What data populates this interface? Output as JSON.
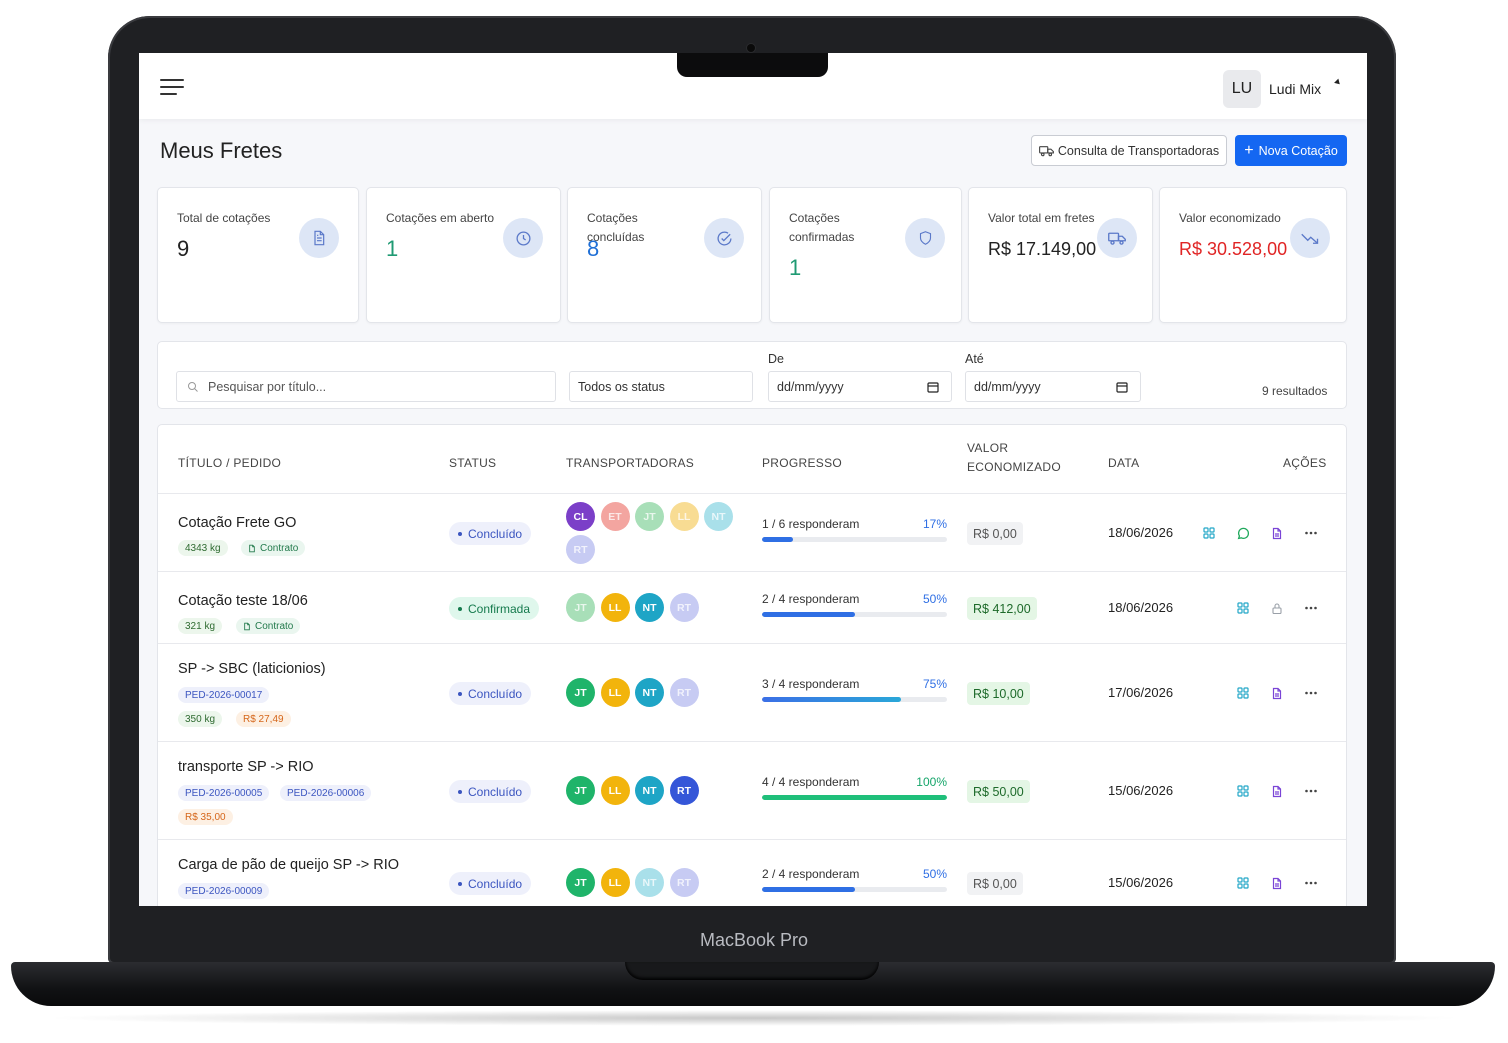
{
  "device_label": "MacBook Pro",
  "header": {
    "user_initials": "LU",
    "user_name": "Ludi Mix"
  },
  "page": {
    "title": "Meus Fretes",
    "btn_consulta": "Consulta de Transportadoras",
    "btn_nova": "Nova Cotação"
  },
  "cards": [
    {
      "label": "Total de cotações",
      "value": "9",
      "color": "#222222",
      "icon": "document-icon"
    },
    {
      "label": "Cotações em aberto",
      "value": "1",
      "color": "#1f9a73",
      "icon": "clock-icon"
    },
    {
      "label": "Cotações concluídas",
      "value": "8",
      "color": "#1f6fd6",
      "icon": "check-circle-icon"
    },
    {
      "label": "Cotações confirmadas",
      "value": "1",
      "color": "#1f9a73",
      "icon": "shield-icon"
    },
    {
      "label": "Valor total em fretes",
      "value": "R$ 17.149,00",
      "color": "#222222",
      "icon": "truck-icon"
    },
    {
      "label": "Valor economizado",
      "value": "R$ 30.528,00",
      "color": "#e02424",
      "icon": "trend-down-icon"
    }
  ],
  "filters": {
    "search_placeholder": "Pesquisar por título...",
    "status_value": "Todos os status",
    "from_label": "De",
    "from_value": "dd/mm/yyyy",
    "to_label": "Até",
    "to_value": "dd/mm/yyyy",
    "results": "9 resultados"
  },
  "table": {
    "headers": {
      "title": "TÍTULO / PEDIDO",
      "status": "STATUS",
      "carriers": "TRANSPORTADORAS",
      "progress": "PROGRESSO",
      "saved": "VALOR ECONOMIZADO",
      "date": "DATA",
      "actions": "AÇÕES"
    },
    "rows": [
      {
        "title": "Cotação Frete GO",
        "tags": [
          {
            "text": "4343 kg",
            "kind": "weight"
          },
          {
            "text": "Contrato",
            "kind": "contract"
          }
        ],
        "status": "Concluído",
        "carriers": [
          {
            "initials": "CL",
            "color": "#7b3fc8",
            "faded": false
          },
          {
            "initials": "ET",
            "color": "#f3a5a0",
            "faded": true
          },
          {
            "initials": "JT",
            "color": "#a8dfb8",
            "faded": true
          },
          {
            "initials": "LL",
            "color": "#f8dc93",
            "faded": true
          },
          {
            "initials": "NT",
            "color": "#a9e0ea",
            "faded": true
          },
          {
            "initials": "RT",
            "color": "#c7cbf3",
            "faded": true
          }
        ],
        "progress_text": "1 / 6 responderam",
        "progress_pct_label": "17%",
        "progress": 0.17,
        "saved": "R$ 0,00",
        "date": "18/06/2026",
        "actions": [
          "grid-icon",
          "chat-icon",
          "file-icon",
          "more-icon"
        ]
      },
      {
        "title": "Cotação teste 18/06",
        "tags": [
          {
            "text": "321 kg",
            "kind": "weight"
          },
          {
            "text": "Contrato",
            "kind": "contract"
          }
        ],
        "status": "Confirmada",
        "carriers": [
          {
            "initials": "JT",
            "color": "#a8dfb8",
            "faded": true
          },
          {
            "initials": "LL",
            "color": "#f2b40c",
            "faded": false
          },
          {
            "initials": "NT",
            "color": "#1ea5c6",
            "faded": false
          },
          {
            "initials": "RT",
            "color": "#c7cbf3",
            "faded": true
          }
        ],
        "progress_text": "2 / 4 responderam",
        "progress_pct_label": "50%",
        "progress": 0.5,
        "saved": "R$ 412,00",
        "date": "18/06/2026",
        "actions": [
          "grid-icon",
          "lock-icon",
          "more-icon"
        ]
      },
      {
        "title": "SP -> SBC (laticionios)",
        "tags": [
          {
            "text": "PED-2026-00017",
            "kind": "ped"
          },
          {
            "text": "350 kg",
            "kind": "weight"
          },
          {
            "text": "R$ 27,49",
            "kind": "price"
          }
        ],
        "status": "Concluído",
        "carriers": [
          {
            "initials": "JT",
            "color": "#1fb46a",
            "faded": false
          },
          {
            "initials": "LL",
            "color": "#f2b40c",
            "faded": false
          },
          {
            "initials": "NT",
            "color": "#1ea5c6",
            "faded": false
          },
          {
            "initials": "RT",
            "color": "#c7cbf3",
            "faded": true
          }
        ],
        "progress_text": "3 / 4 responderam",
        "progress_pct_label": "75%",
        "progress": 0.75,
        "saved": "R$ 10,00",
        "date": "17/06/2026",
        "actions": [
          "grid-icon",
          "file-icon",
          "more-icon"
        ]
      },
      {
        "title": "transporte SP -> RIO",
        "tags": [
          {
            "text": "PED-2026-00005",
            "kind": "ped"
          },
          {
            "text": "PED-2026-00006",
            "kind": "ped"
          },
          {
            "text": "R$ 35,00",
            "kind": "price"
          }
        ],
        "status": "Concluído",
        "carriers": [
          {
            "initials": "JT",
            "color": "#1fb46a",
            "faded": false
          },
          {
            "initials": "LL",
            "color": "#f2b40c",
            "faded": false
          },
          {
            "initials": "NT",
            "color": "#1ea5c6",
            "faded": false
          },
          {
            "initials": "RT",
            "color": "#3556d8",
            "faded": false
          }
        ],
        "progress_text": "4 / 4 responderam",
        "progress_pct_label": "100%",
        "progress": 1.0,
        "saved": "R$ 50,00",
        "date": "15/06/2026",
        "actions": [
          "grid-icon",
          "file-icon",
          "more-icon"
        ]
      },
      {
        "title": "Carga de pão de queijo SP -> RIO",
        "tags": [
          {
            "text": "PED-2026-00009",
            "kind": "ped"
          }
        ],
        "status": "Concluído",
        "carriers": [
          {
            "initials": "JT",
            "color": "#1fb46a",
            "faded": false
          },
          {
            "initials": "LL",
            "color": "#f2b40c",
            "faded": false
          },
          {
            "initials": "NT",
            "color": "#a9e0ea",
            "faded": true
          },
          {
            "initials": "RT",
            "color": "#c7cbf3",
            "faded": true
          }
        ],
        "progress_text": "2 / 4 responderam",
        "progress_pct_label": "50%",
        "progress": 0.5,
        "saved": "R$ 0,00",
        "date": "15/06/2026",
        "actions": [
          "grid-icon",
          "file-icon",
          "more-icon"
        ]
      }
    ]
  }
}
